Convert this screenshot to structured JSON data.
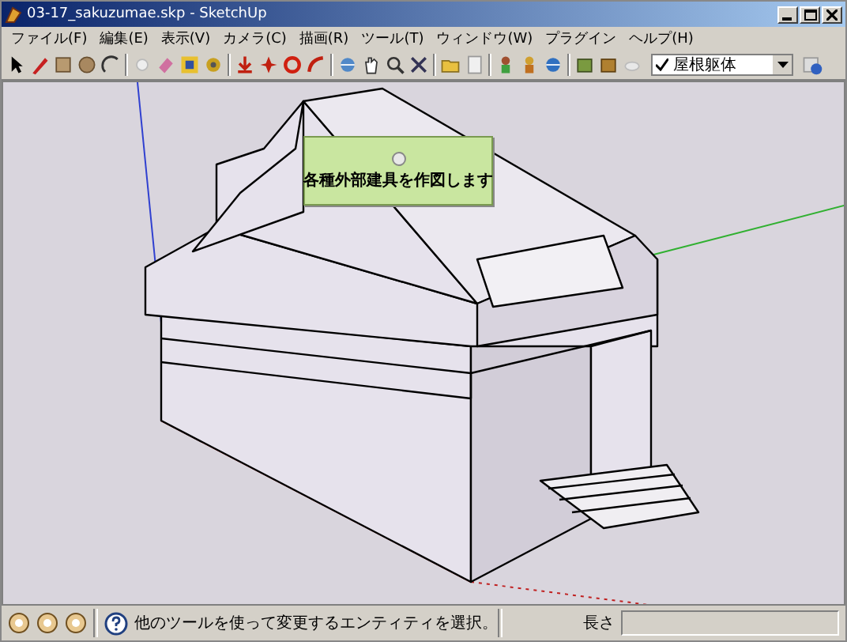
{
  "window": {
    "title": "03-17_sakuzumae.skp - SketchUp"
  },
  "menu": [
    "ファイル(F)",
    "編集(E)",
    "表示(V)",
    "カメラ(C)",
    "描画(R)",
    "ツール(T)",
    "ウィンドウ(W)",
    "プラグイン",
    "ヘルプ(H)"
  ],
  "layer_dropdown": {
    "value": "屋根躯体"
  },
  "tooltip": {
    "text": "各種外部建具を作図します"
  },
  "status_bar": {
    "message": "他のツールを使って変更するエンティティを選択。",
    "measure_label": "長さ"
  }
}
